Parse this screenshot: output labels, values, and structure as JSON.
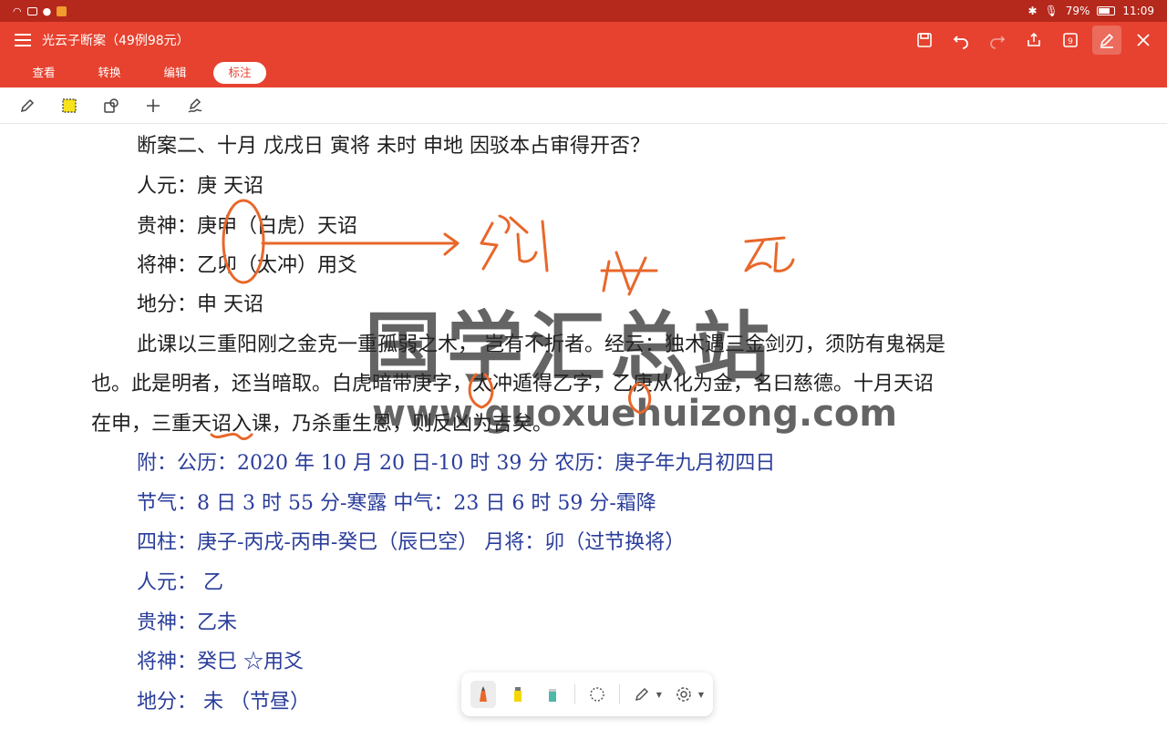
{
  "status": {
    "battery": "79%",
    "time": "11:09",
    "battery_level": 0.79
  },
  "header": {
    "doc_title": "光云子断案（49例98元）",
    "tabs": [
      {
        "label": "查看"
      },
      {
        "label": "转换"
      },
      {
        "label": "编辑"
      },
      {
        "label": "标注",
        "active": true
      }
    ]
  },
  "document": {
    "lines": [
      "断案二、十月  戊戌日  寅将  未时  申地    因驳本占审得开否？",
      "人元：庚      天诏",
      "贵神：庚申（白虎）天诏",
      "将神：乙卯（太冲）用爻",
      "地分：申      天诏",
      "此课以三重阳刚之金克一重孤弱之木，  岂有不折者。经云：独木遇三金剑刃，须防有鬼祸是",
      "也。此是明者，还当暗取。白虎暗带庚字，太冲遁得乙字，乙庚从化为金，名曰慈德。十月天诏",
      "在申，三重天诏入课，乃杀重生恩，则反凶为吉矣。",
      "附：公历：2020 年 10 月 20 日-10 时 39 分    农历：庚子年九月初四日",
      "节气：8 日 3 时 55 分-寒露    中气：23 日 6 时 59 分-霜降",
      "四柱：庚子-丙戌-丙申-癸巳（辰巳空）    月将：卯（过节换将）",
      "人元：    乙",
      "贵神：乙未",
      "将神：癸巳    ☆用爻",
      "地分：    未  （节昼）"
    ],
    "watermark_cn": "国学汇总站",
    "watermark_url": "www.guoxuehuizong.com"
  },
  "colors": {
    "status_bar": "#b5281c",
    "header": "#e6422f",
    "ink": "#e8672a",
    "body_text": "#1e1e1e",
    "blue_text": "#2a3d9a"
  }
}
